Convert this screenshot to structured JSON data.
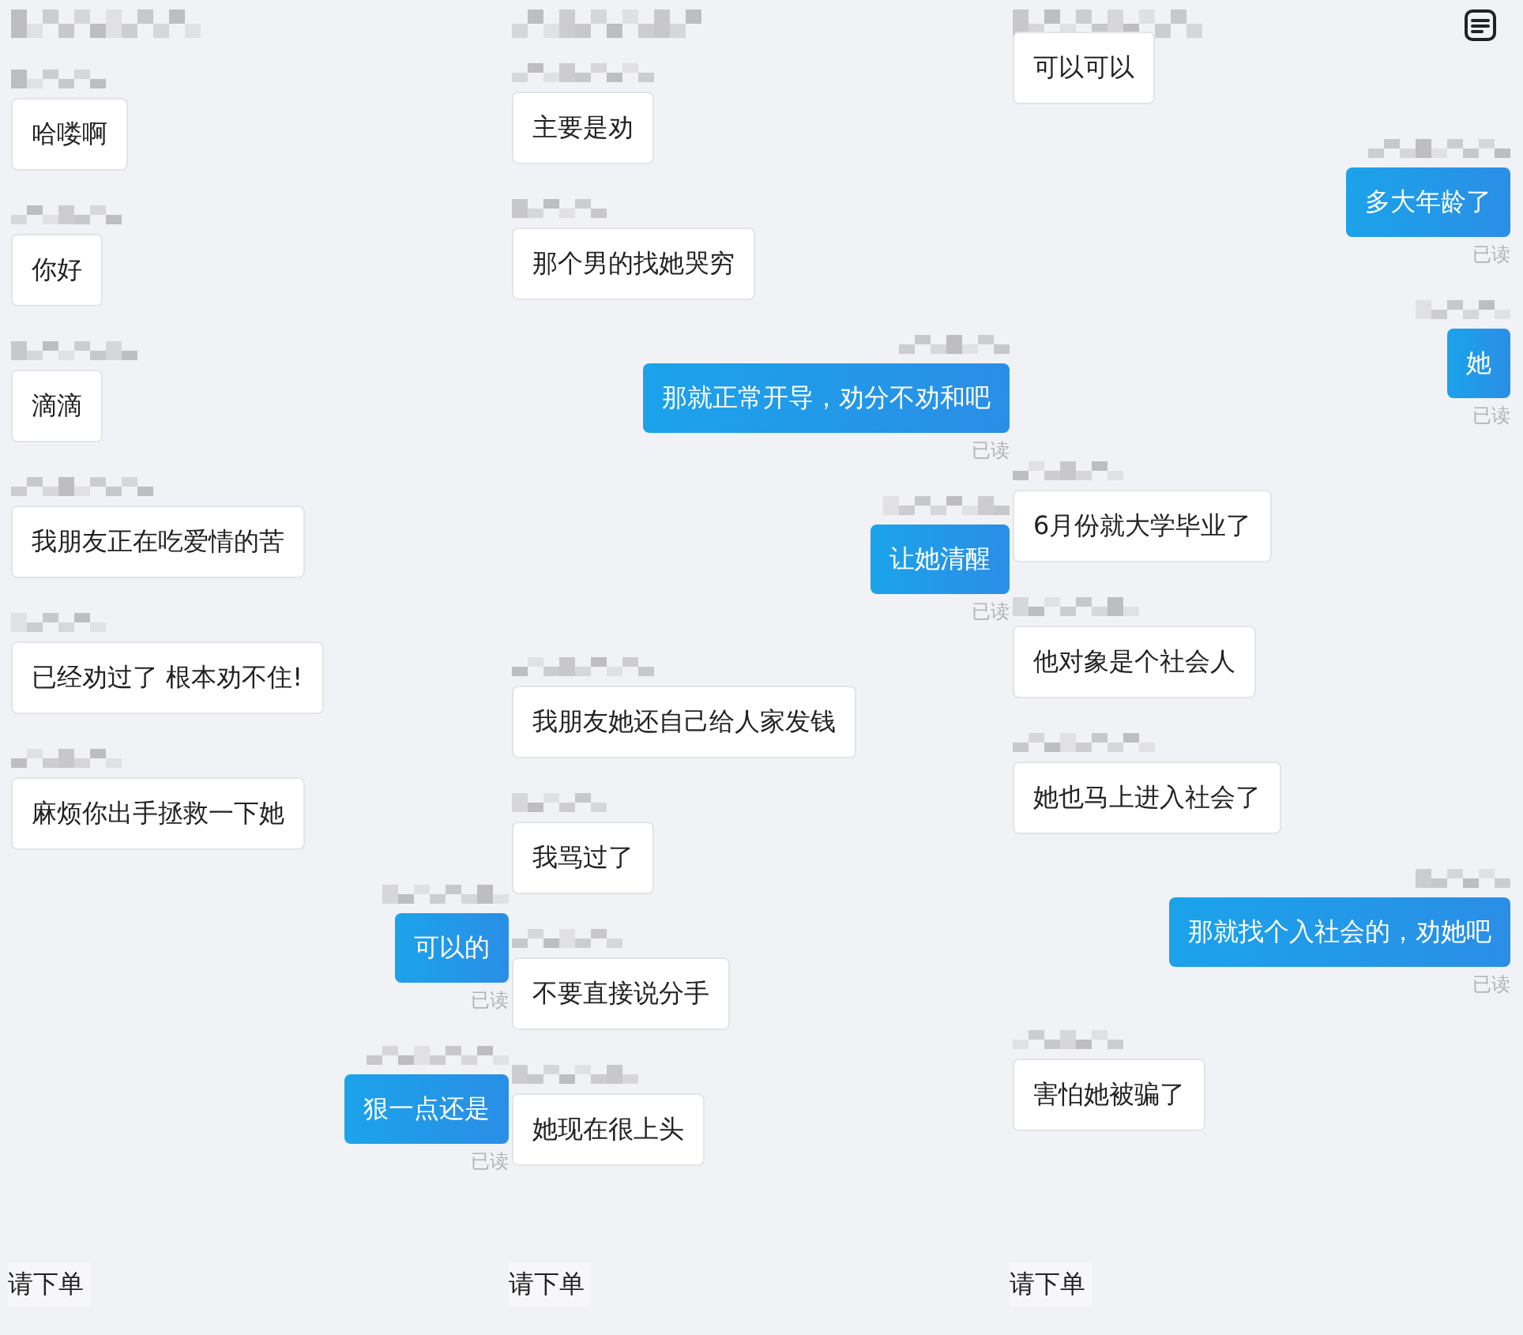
{
  "columns": [
    {
      "messages": [
        {
          "kind": "incoming",
          "text": "哈喽啊"
        },
        {
          "kind": "incoming",
          "text": "你好"
        },
        {
          "kind": "incoming",
          "text": "滴滴"
        },
        {
          "kind": "incoming",
          "text": "我朋友正在吃爱情的苦"
        },
        {
          "kind": "incoming",
          "text": "已经劝过了 根本劝不住!"
        },
        {
          "kind": "incoming",
          "text": "麻烦你出手拯救一下她"
        },
        {
          "kind": "outgoing",
          "text": "可以的",
          "status": "已读"
        },
        {
          "kind": "outgoing",
          "text": "狠一点还是",
          "status": "已读"
        }
      ],
      "footer": "请下单"
    },
    {
      "messages": [
        {
          "kind": "incoming",
          "text": "主要是劝"
        },
        {
          "kind": "incoming",
          "text": "那个男的找她哭穷"
        },
        {
          "kind": "outgoing",
          "text": "那就正常开导，劝分不劝和吧",
          "status": "已读"
        },
        {
          "kind": "outgoing",
          "text": "让她清醒",
          "status": "已读"
        },
        {
          "kind": "incoming",
          "text": "我朋友她还自己给人家发钱"
        },
        {
          "kind": "incoming",
          "text": "我骂过了"
        },
        {
          "kind": "incoming",
          "text": "不要直接说分手"
        },
        {
          "kind": "incoming",
          "text": "她现在很上头"
        }
      ],
      "footer": "请下单"
    },
    {
      "messages": [
        {
          "kind": "incoming",
          "text": "可以可以"
        },
        {
          "kind": "outgoing",
          "text": "多大年龄了",
          "status": "已读"
        },
        {
          "kind": "outgoing",
          "text": "她",
          "status": "已读"
        },
        {
          "kind": "incoming",
          "text": "6月份就大学毕业了"
        },
        {
          "kind": "incoming",
          "text": "他对象是个社会人"
        },
        {
          "kind": "incoming",
          "text": "她也马上进入社会了"
        },
        {
          "kind": "outgoing",
          "text": "那就找个入社会的，劝她吧",
          "status": "已读"
        },
        {
          "kind": "incoming",
          "text": "害怕她被骗了"
        }
      ],
      "footer": "请下单"
    }
  ]
}
